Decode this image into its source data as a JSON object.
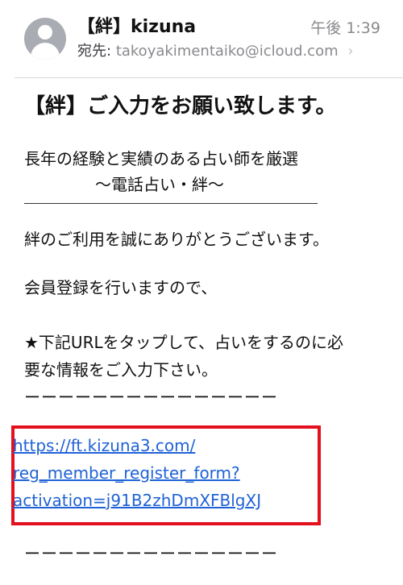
{
  "header": {
    "sender": "【絆】kizuna",
    "time": "午後 1:39",
    "recipient_label": "宛先:",
    "recipient": "takoyakimentaiko@icloud.com",
    "chevron": "›"
  },
  "email": {
    "subject": "【絆】ご入力をお願い致します。",
    "line1": "長年の経験と実績のある占い師を厳選",
    "line2": "〜電話占い・絆〜",
    "line3": "絆のご利用を誠にありがとうございます。",
    "line4": "会員登録を行いますので、",
    "line5": "★下記URLをタップして、占いをするのに必",
    "line6": "要な情報をご入力下さい。",
    "divider": "ーーーーーーーーーーーーーーー",
    "link_lines": [
      "https://ft.kizuna3.com/",
      "reg_member_register_form?",
      "activation=j91B2zhDmXFBlgXJ"
    ],
    "divider2": "ーーーーーーーーーーーーーーー"
  },
  "icons": {
    "avatar": "person-silhouette",
    "chevron": "chevron-right"
  },
  "colors": {
    "link": "#1f62d6",
    "highlight_border": "#e3101e",
    "secondary_text": "#8a8a8e",
    "avatar_bg": "#a9acb3"
  }
}
